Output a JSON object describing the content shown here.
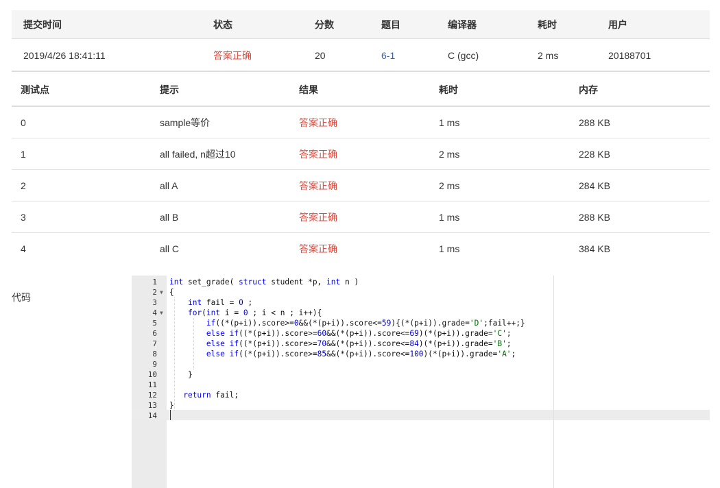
{
  "submission": {
    "headers": {
      "time": "提交时间",
      "status": "状态",
      "score": "分数",
      "problem": "题目",
      "compiler": "编译器",
      "duration": "耗时",
      "user": "用户"
    },
    "row": {
      "time": "2019/4/26 18:41:11",
      "status": "答案正确",
      "score": "20",
      "problem": "6-1",
      "compiler": "C (gcc)",
      "duration": "2 ms",
      "user": "20188701"
    }
  },
  "cases": {
    "headers": {
      "id": "测试点",
      "hint": "提示",
      "result": "结果",
      "duration": "耗时",
      "memory": "内存"
    },
    "rows": [
      {
        "id": "0",
        "hint": "sample等价",
        "result": "答案正确",
        "duration": "1 ms",
        "memory": "288 KB"
      },
      {
        "id": "1",
        "hint": "all failed, n超过10",
        "result": "答案正确",
        "duration": "2 ms",
        "memory": "228 KB"
      },
      {
        "id": "2",
        "hint": "all A",
        "result": "答案正确",
        "duration": "2 ms",
        "memory": "284 KB"
      },
      {
        "id": "3",
        "hint": "all B",
        "result": "答案正确",
        "duration": "1 ms",
        "memory": "288 KB"
      },
      {
        "id": "4",
        "hint": "all C",
        "result": "答案正确",
        "duration": "1 ms",
        "memory": "384 KB"
      }
    ]
  },
  "code": {
    "label": "代码",
    "lines": [
      "int set_grade( struct student *p, int n )",
      "{",
      "    int fail = 0 ;",
      "    for(int i = 0 ; i < n ; i++){",
      "        if((*(p+i)).score>=0&&(*(p+i)).score<=59){(*(p+i)).grade='D';fail++;}",
      "        else if((*(p+i)).score>=60&&(*(p+i)).score<=69)(*(p+i)).grade='C';",
      "        else if((*(p+i)).score>=70&&(*(p+i)).score<=84)(*(p+i)).grade='B';",
      "        else if((*(p+i)).score>=85&&(*(p+i)).score<=100)(*(p+i)).grade='A';",
      "",
      "    }",
      "",
      "   return fail;",
      "}",
      ""
    ]
  },
  "colors": {
    "accepted": "#e04a3d",
    "link": "#3a62a8",
    "keyword": "#0000ff",
    "number": "#0000cd",
    "string": "#036a07"
  }
}
